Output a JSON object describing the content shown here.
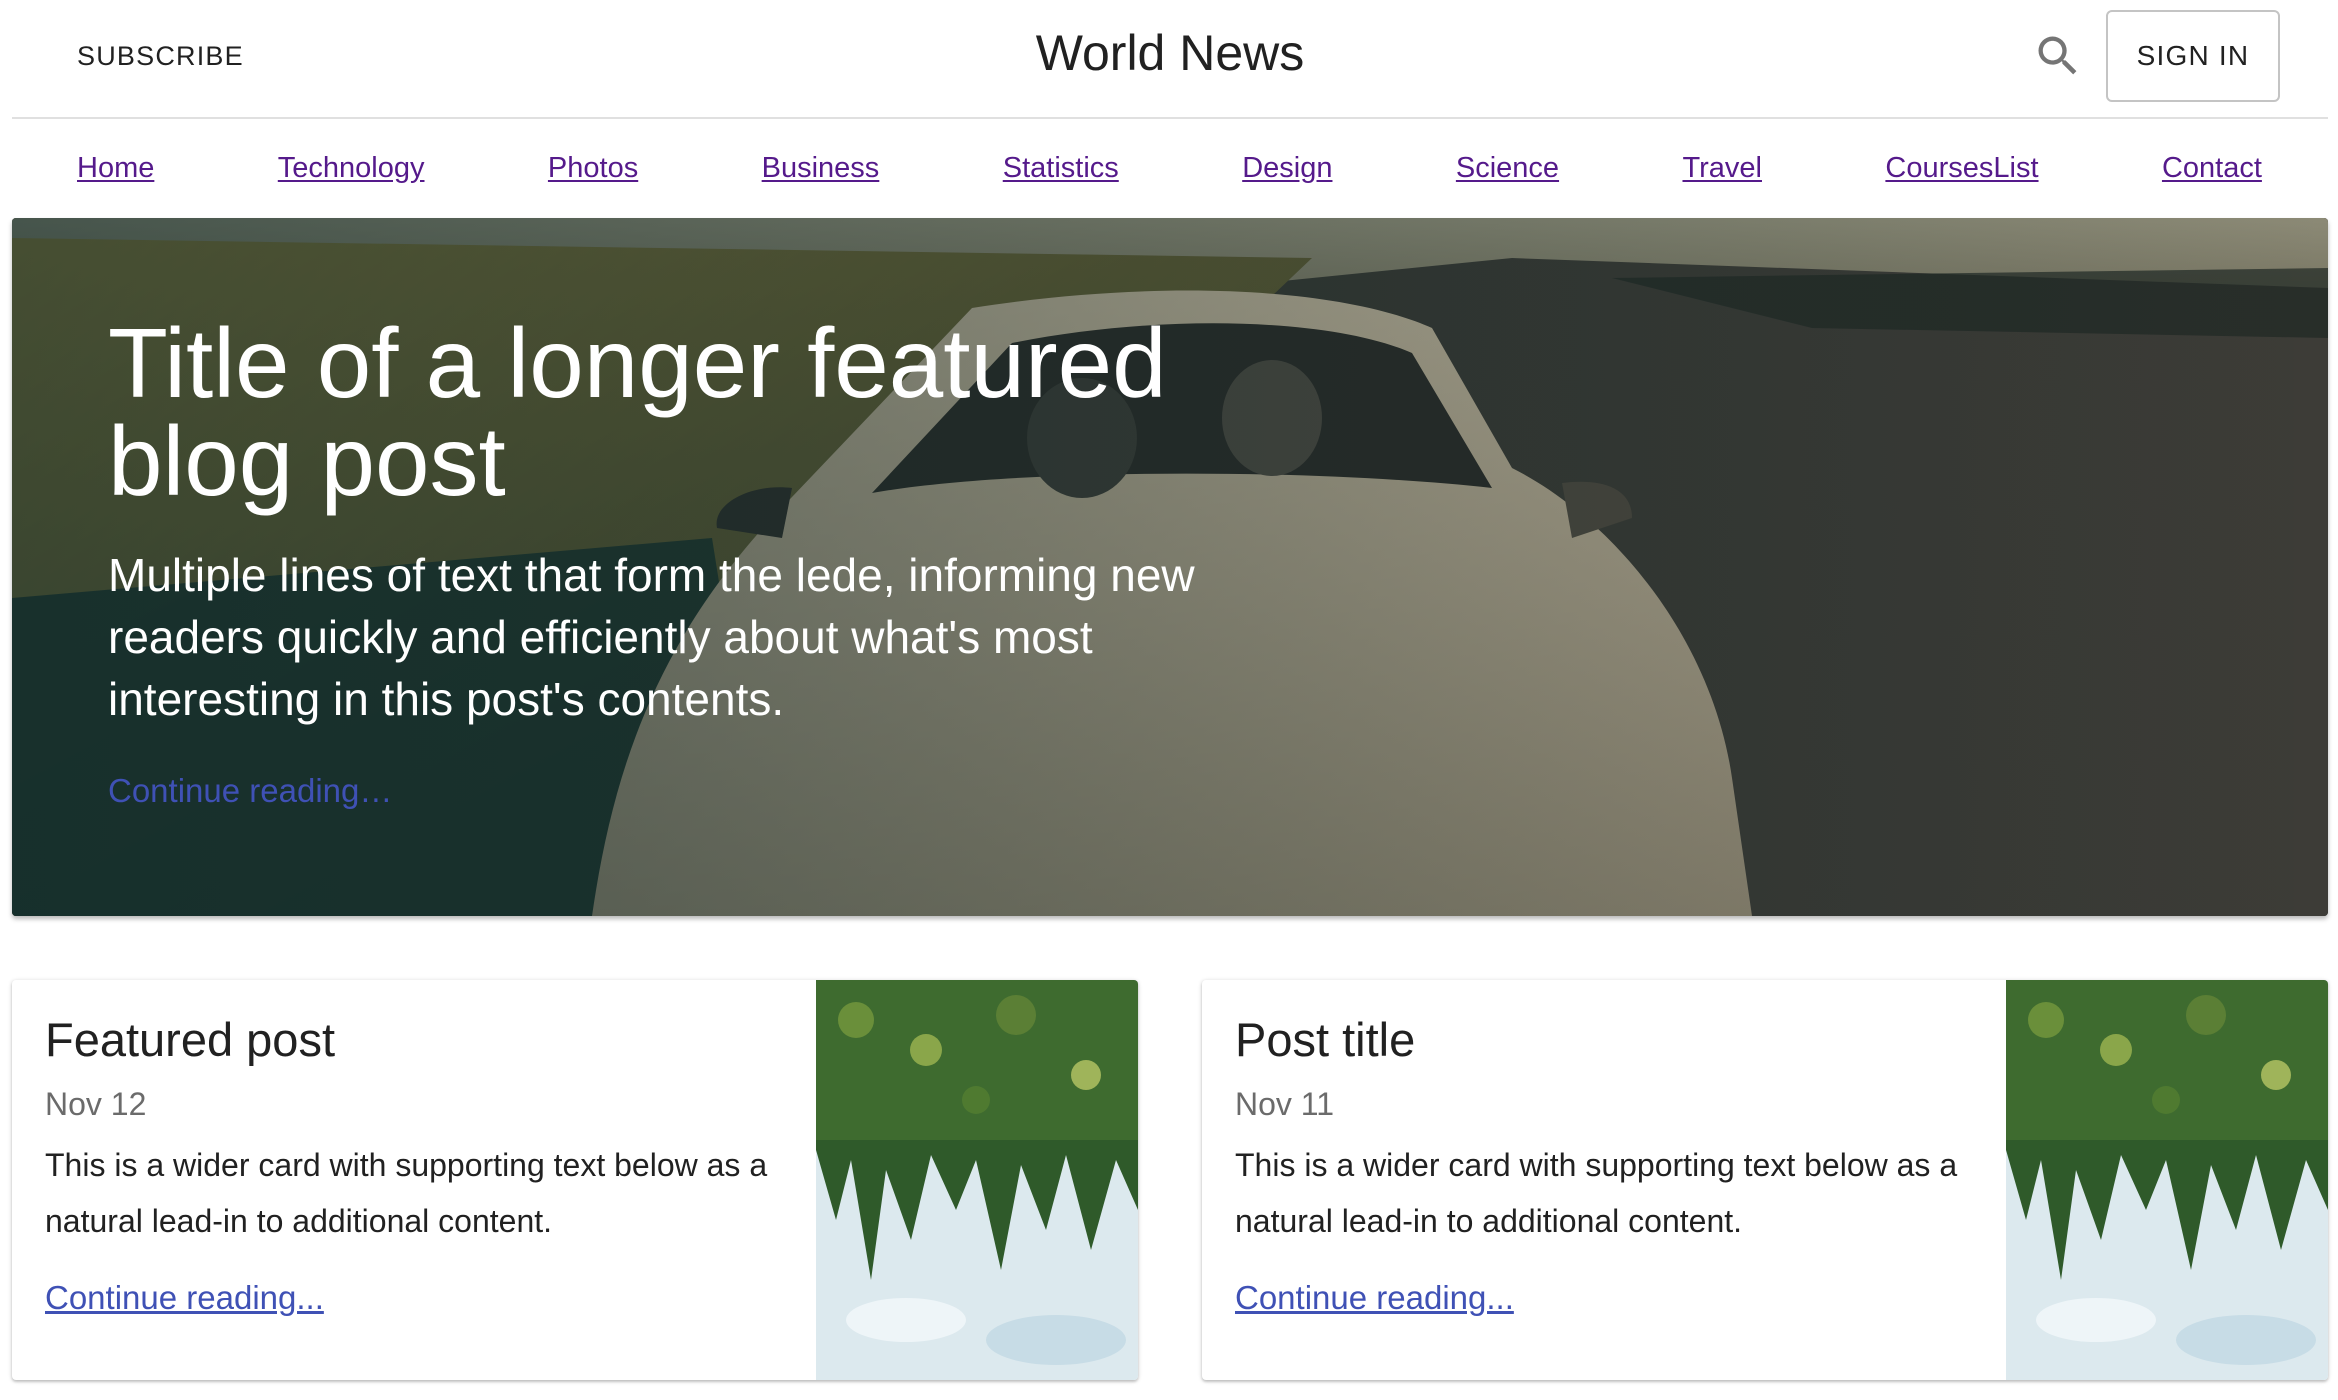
{
  "header": {
    "subscribe_label": "SUBSCRIBE",
    "site_title": "World News",
    "search_icon": "search-icon",
    "signin_label": "SIGN IN"
  },
  "nav": {
    "items": [
      {
        "label": "Home"
      },
      {
        "label": "Technology"
      },
      {
        "label": "Photos"
      },
      {
        "label": "Business"
      },
      {
        "label": "Statistics"
      },
      {
        "label": "Design"
      },
      {
        "label": "Science"
      },
      {
        "label": "Travel"
      },
      {
        "label": "CoursesList"
      },
      {
        "label": "Contact"
      }
    ]
  },
  "hero": {
    "title": "Title of a longer featured blog post",
    "lede": "Multiple lines of text that form the lede, informing new readers quickly and efficiently about what's most interesting in this post's contents.",
    "link_text": "Continue reading…"
  },
  "cards": [
    {
      "title": "Featured post",
      "date": "Nov 12",
      "text": "This is a wider card with supporting text below as a natural lead-in to additional content.",
      "link_text": "Continue reading..."
    },
    {
      "title": "Post title",
      "date": "Nov 11",
      "text": "This is a wider card with supporting text below as a natural lead-in to additional content.",
      "link_text": "Continue reading..."
    }
  ],
  "colors": {
    "link_visited": "#551a8b",
    "accent": "#3f51b5",
    "muted_text": "#6b6b6b"
  }
}
